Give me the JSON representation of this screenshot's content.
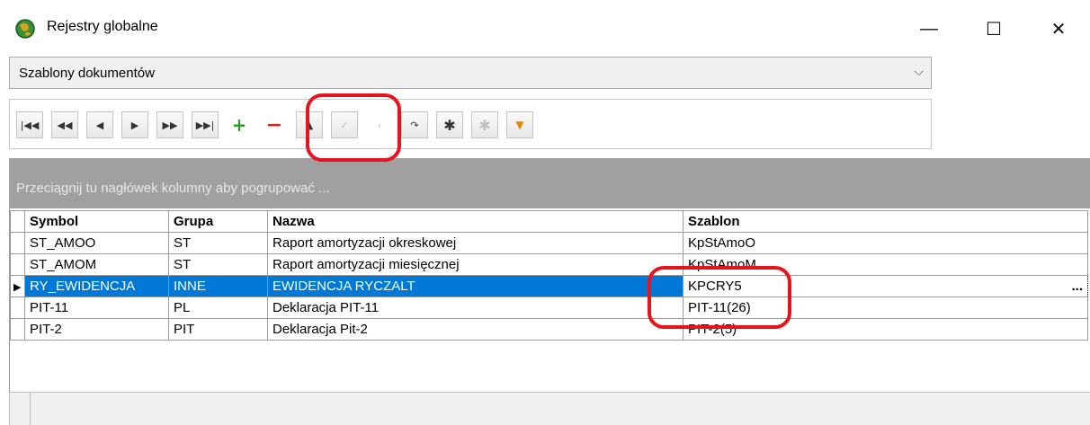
{
  "window": {
    "title": "Rejestry globalne",
    "minimize_glyph": "—",
    "maximize_glyph": "☐",
    "close_glyph": "✕"
  },
  "register_select": {
    "value": "Szablony dokumentów"
  },
  "toolbar": {
    "buttons": [
      {
        "name": "first-record-button",
        "glyph": "⏮",
        "disabled": false
      },
      {
        "name": "prev-page-button",
        "glyph": "◀◀",
        "disabled": false
      },
      {
        "name": "prev-record-button",
        "glyph": "◀",
        "disabled": false
      },
      {
        "name": "next-record-button",
        "glyph": "▶",
        "disabled": false
      },
      {
        "name": "next-page-button",
        "glyph": "▶▶",
        "disabled": false
      },
      {
        "name": "last-record-button",
        "glyph": "⏭",
        "disabled": false
      },
      {
        "name": "add-record-button",
        "glyph": "+",
        "disabled": false
      },
      {
        "name": "delete-record-button",
        "glyph": "−",
        "disabled": false
      },
      {
        "name": "edit-record-button",
        "glyph": "▲",
        "disabled": false
      },
      {
        "name": "post-record-button",
        "glyph": "✓",
        "disabled": true
      },
      {
        "name": "cancel-edit-button",
        "glyph": "✕",
        "disabled": true
      },
      {
        "name": "refresh-button",
        "glyph": "↷",
        "disabled": false
      },
      {
        "name": "filter-clear-button",
        "glyph": "✱",
        "disabled": false
      },
      {
        "name": "filter-disabled-button",
        "glyph": "✱",
        "disabled": true
      },
      {
        "name": "filter-button",
        "glyph": "▼",
        "disabled": false
      }
    ]
  },
  "group_panel": {
    "hint": "Przeciągnij tu nagłówek kolumny aby pogrupować ..."
  },
  "grid": {
    "columns": [
      "Symbol",
      "Grupa",
      "Nazwa",
      "Szablon"
    ],
    "rows": [
      {
        "symbol": "ST_AMOO",
        "grupa": "ST",
        "nazwa": "Raport amortyzacji okreskowej",
        "szablon": "KpStAmoO"
      },
      {
        "symbol": "ST_AMOM",
        "grupa": "ST",
        "nazwa": "Raport amortyzacji miesięcznej",
        "szablon": "KpStAmoM"
      },
      {
        "symbol": "RY_EWIDENCJA",
        "grupa": "INNE",
        "nazwa": "EWIDENCJA  RYCZALT",
        "szablon": "KPCRY5"
      },
      {
        "symbol": "PIT-11",
        "grupa": "PL",
        "nazwa": "Deklaracja PIT-11",
        "szablon": "PIT-11(26)"
      },
      {
        "symbol": "PIT-2",
        "grupa": "PIT",
        "nazwa": "Deklaracja Pit-2",
        "szablon": "PIT-2(5)"
      }
    ],
    "selected_row_indicator": "▶",
    "ellipsis": "..."
  },
  "colors": {
    "selection": "#0078d7",
    "annotation": "#e8141c",
    "group_panel": "#a0a0a0"
  }
}
